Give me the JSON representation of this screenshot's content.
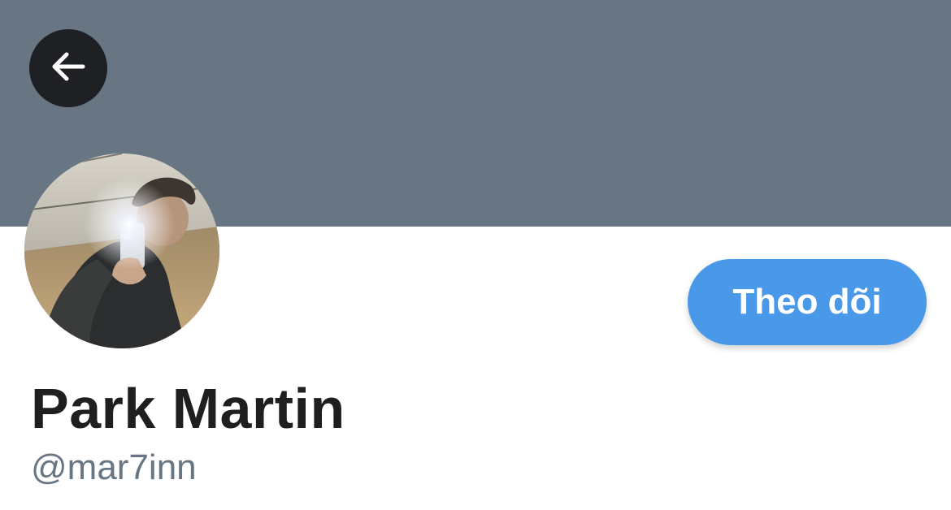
{
  "header": {
    "back_icon": "arrow-left-icon",
    "banner_color": "#687684"
  },
  "profile": {
    "display_name": "Park Martin",
    "username": "@mar7inn",
    "avatar": "profile-photo"
  },
  "actions": {
    "follow_label": "Theo dõi",
    "follow_color": "#4a99e9"
  }
}
